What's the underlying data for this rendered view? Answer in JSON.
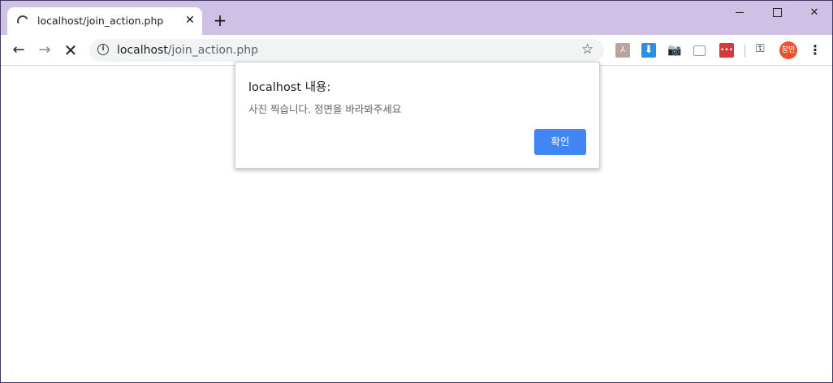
{
  "tab": {
    "title": "localhost/join_action.php",
    "close_glyph": "✕"
  },
  "new_tab_glyph": "+",
  "window_controls": {
    "close_glyph": "✕"
  },
  "toolbar": {
    "back_glyph": "←",
    "forward_glyph": "→",
    "stop_glyph": "✕",
    "url_host": "localhost",
    "url_path": "/join_action.php",
    "star_glyph": "☆",
    "info_glyph": "i",
    "avatar_text": "창민",
    "menu_glyph": "⋮",
    "key_glyph": "⚿"
  },
  "extensions": [
    {
      "name": "pdf-extension-icon",
      "glyph": "⅄"
    },
    {
      "name": "download-extension-icon",
      "glyph": "⬇"
    },
    {
      "name": "camera-extension-icon",
      "glyph": "📷"
    },
    {
      "name": "cast-extension-icon",
      "glyph": ""
    },
    {
      "name": "red-extension-icon",
      "glyph": "•••"
    }
  ],
  "dialog": {
    "title": "localhost 내용:",
    "message": "사진 찍습니다. 정면을 바라봐주세요",
    "ok_label": "확인"
  },
  "colors": {
    "tabstrip": "#cfc1e6",
    "dialog_button": "#4285f4",
    "avatar": "#e8542c"
  }
}
